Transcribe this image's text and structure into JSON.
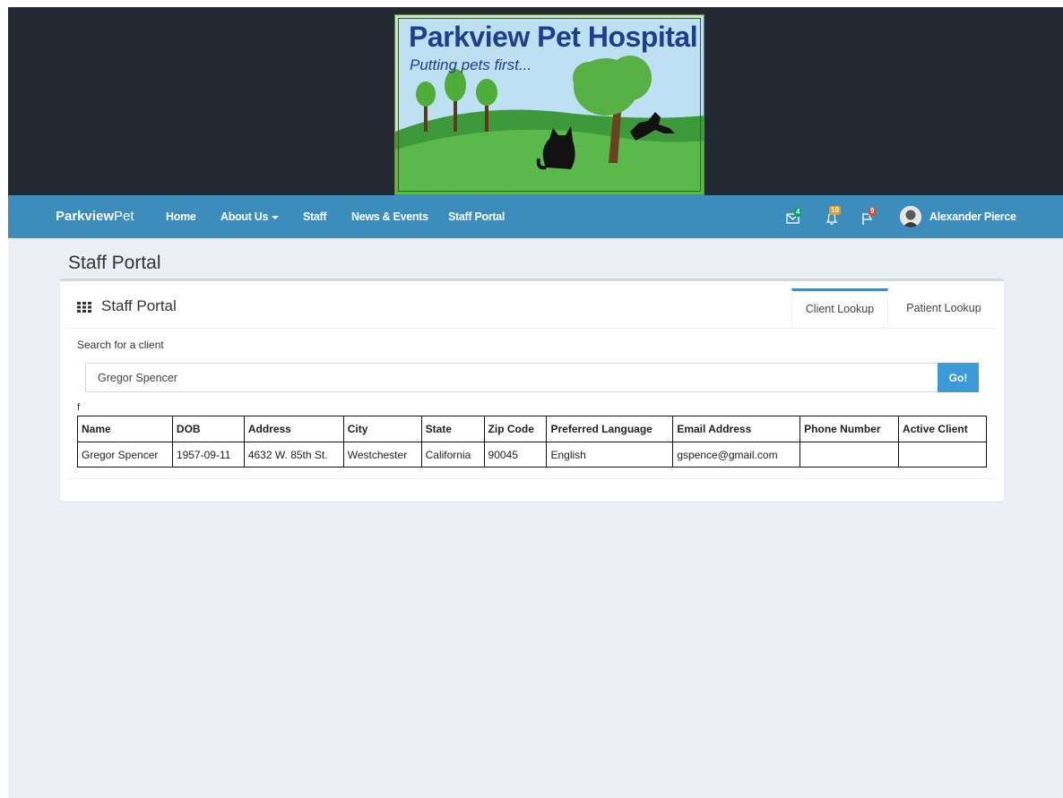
{
  "logo": {
    "title": "Parkview Pet Hospital",
    "tagline": "Putting pets first..."
  },
  "navbar": {
    "brand_bold": "Parkview",
    "brand_light": "Pet",
    "items": [
      {
        "label": "Home"
      },
      {
        "label": "About Us"
      },
      {
        "label": "Staff"
      },
      {
        "label": "News & Events"
      },
      {
        "label": "Staff Portal"
      }
    ],
    "notifications": [
      {
        "icon": "envelope-icon",
        "count": "4",
        "color": "#00a65a"
      },
      {
        "icon": "bell-icon",
        "count": "10",
        "color": "#f39c12"
      },
      {
        "icon": "flag-icon",
        "count": "9",
        "color": "#dd4b39"
      }
    ],
    "user_name": "Alexander Pierce"
  },
  "page": {
    "title": "Staff Portal"
  },
  "box": {
    "icon": "grid-icon",
    "title": "Staff Portal",
    "tabs": [
      {
        "label": "Client Lookup",
        "active": true
      },
      {
        "label": "Patient Lookup",
        "active": false
      }
    ]
  },
  "search": {
    "label": "Search for a client",
    "value": "Gregor Spencer",
    "button_label": "Go!"
  },
  "stray_text": "f",
  "table": {
    "columns": [
      "Name",
      "DOB",
      "Address",
      "City",
      "State",
      "Zip Code",
      "Preferred Language",
      "Email Address",
      "Phone Number",
      "Active Client"
    ],
    "rows": [
      [
        "Gregor Spencer",
        "1957-09-11",
        "4632 W. 85th St.",
        "Westchester",
        "California",
        "90045",
        "English",
        "gspence@gmail.com",
        "",
        ""
      ]
    ]
  },
  "colors": {
    "navbar": "#3c8dbc",
    "banner": "#232a33",
    "go_button": "#3c9ad6",
    "content_bg": "#ecf0f5"
  }
}
